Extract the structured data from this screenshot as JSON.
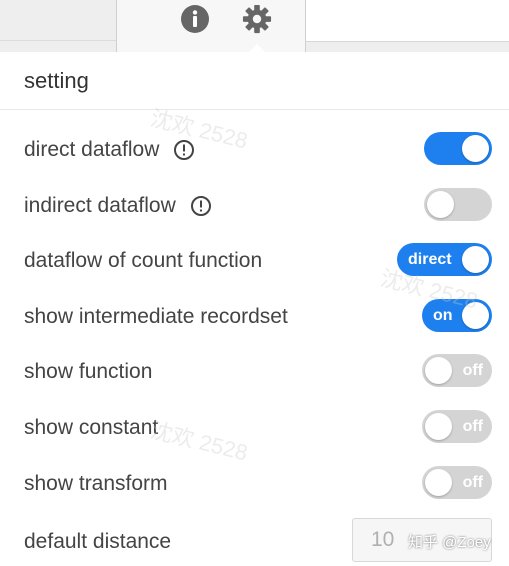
{
  "tabs": {
    "info_icon": "info-icon",
    "settings_icon": "gear-icon"
  },
  "panel": {
    "title": "setting"
  },
  "settings": {
    "direct_dataflow": {
      "label": "direct dataflow",
      "state": "on",
      "switch_text": ""
    },
    "indirect_dataflow": {
      "label": "indirect dataflow",
      "state": "off",
      "switch_text": ""
    },
    "dataflow_of_count_function": {
      "label": "dataflow of count function",
      "state": "on",
      "switch_text": "direct"
    },
    "show_intermediate_recordset": {
      "label": "show intermediate recordset",
      "state": "on",
      "switch_text": "on"
    },
    "show_function": {
      "label": "show function",
      "state": "off",
      "switch_text": "off"
    },
    "show_constant": {
      "label": "show constant",
      "state": "off",
      "switch_text": "off"
    },
    "show_transform": {
      "label": "show transform",
      "state": "off",
      "switch_text": "off"
    },
    "default_distance": {
      "label": "default distance",
      "value": "10"
    }
  },
  "watermark": {
    "text": "沈欢 2528",
    "credit": "知乎 @Zoey"
  },
  "colors": {
    "switch_on": "#1e80ef",
    "switch_off": "#d4d4d4",
    "label_text": "#444444"
  }
}
